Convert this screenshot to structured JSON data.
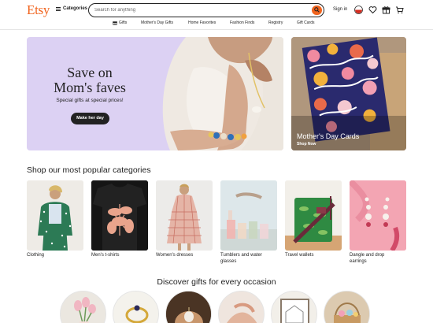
{
  "header": {
    "logo": "Etsy",
    "categories_label": "Categories",
    "search_placeholder": "Search for anything",
    "signin_label": "Sign in"
  },
  "nav": {
    "items": [
      "Gifts",
      "Mother's Day Gifts",
      "Home Favorites",
      "Fashion Finds",
      "Registry",
      "Gift Cards"
    ]
  },
  "hero": {
    "title_line1": "Save on",
    "title_line2": "Mom's faves",
    "subtitle": "Special gifts at special prices!",
    "button_label": "Make her day"
  },
  "promo_card": {
    "title": "Mother's Day Cards",
    "link": "Shop Now"
  },
  "popular": {
    "title": "Shop our most popular categories",
    "items": [
      {
        "label_line1": "Clothing",
        "label_line2": ""
      },
      {
        "label_line1": "Men's t-shirts",
        "label_line2": ""
      },
      {
        "label_line1": "Women's dresses",
        "label_line2": ""
      },
      {
        "label_line1": "Tumblers and water",
        "label_line2": "glasses"
      },
      {
        "label_line1": "Travel wallets",
        "label_line2": ""
      },
      {
        "label_line1": "Dangle and drop",
        "label_line2": "earrings"
      }
    ]
  },
  "occasions": {
    "title": "Discover gifts for every occasion"
  },
  "colors": {
    "brand": "#f1641e",
    "hero_bg": "#dcd1f3"
  }
}
